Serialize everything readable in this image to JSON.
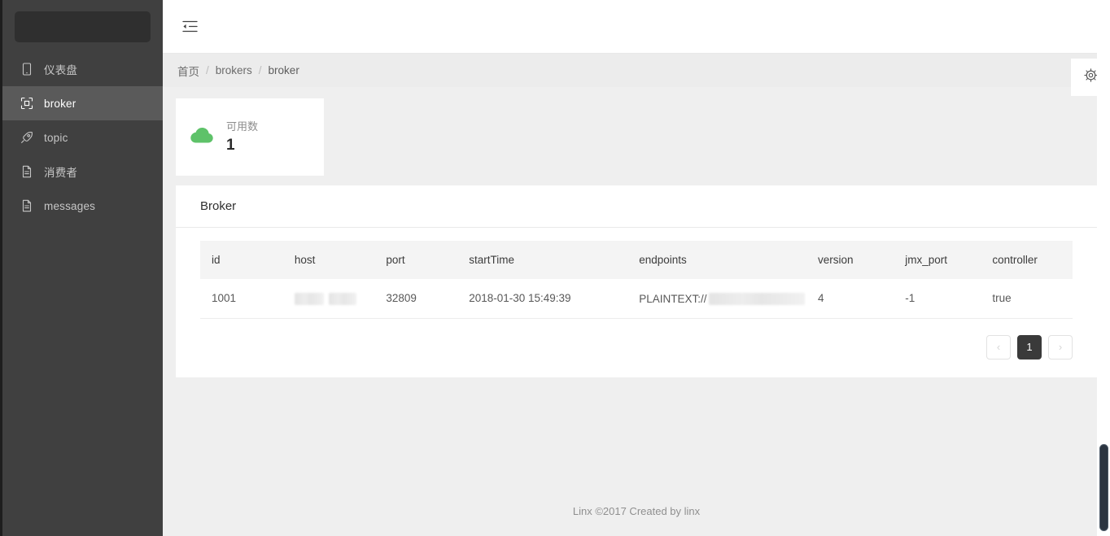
{
  "sidebar": {
    "logo_placeholder": "",
    "items": [
      {
        "label": "仪表盘",
        "icon": "tablet-icon",
        "active": false
      },
      {
        "label": "broker",
        "icon": "scan-icon",
        "active": true
      },
      {
        "label": "topic",
        "icon": "rocket-icon",
        "active": false
      },
      {
        "label": "消费者",
        "icon": "file-icon",
        "active": false
      },
      {
        "label": "messages",
        "icon": "file-icon",
        "active": false
      }
    ]
  },
  "topbar": {
    "fold_icon": "menu-fold-icon"
  },
  "breadcrumb": {
    "items": [
      "首页",
      "brokers",
      "broker"
    ],
    "separator": "/"
  },
  "stat_card": {
    "icon": "cloud-icon",
    "icon_color": "#5ec269",
    "label": "可用数",
    "value": "1"
  },
  "table_card": {
    "title": "Broker",
    "columns": [
      "id",
      "host",
      "port",
      "startTime",
      "endpoints",
      "version",
      "jmx_port",
      "controller"
    ],
    "rows": [
      {
        "id": "1001",
        "host": "",
        "host_redacted": true,
        "port": "32809",
        "startTime": "2018-01-30 15:49:39",
        "endpoints_prefix": "PLAINTEXT://",
        "endpoints_redacted": true,
        "version": "4",
        "jmx_port": "-1",
        "controller": "true"
      }
    ],
    "pagination": {
      "prev": "‹",
      "next": "›",
      "pages": [
        "1"
      ],
      "current": "1"
    }
  },
  "settings": {
    "icon": "gear-icon"
  },
  "footer": {
    "text": "Linx ©2017 Created by linx"
  },
  "colors": {
    "sidebar_bg": "#404040",
    "sidebar_active": "#5a5a5a",
    "content_bg": "#ececec",
    "card_bg": "#ffffff",
    "accent_green": "#5ec269",
    "pagination_active_bg": "#3a3a3a"
  }
}
